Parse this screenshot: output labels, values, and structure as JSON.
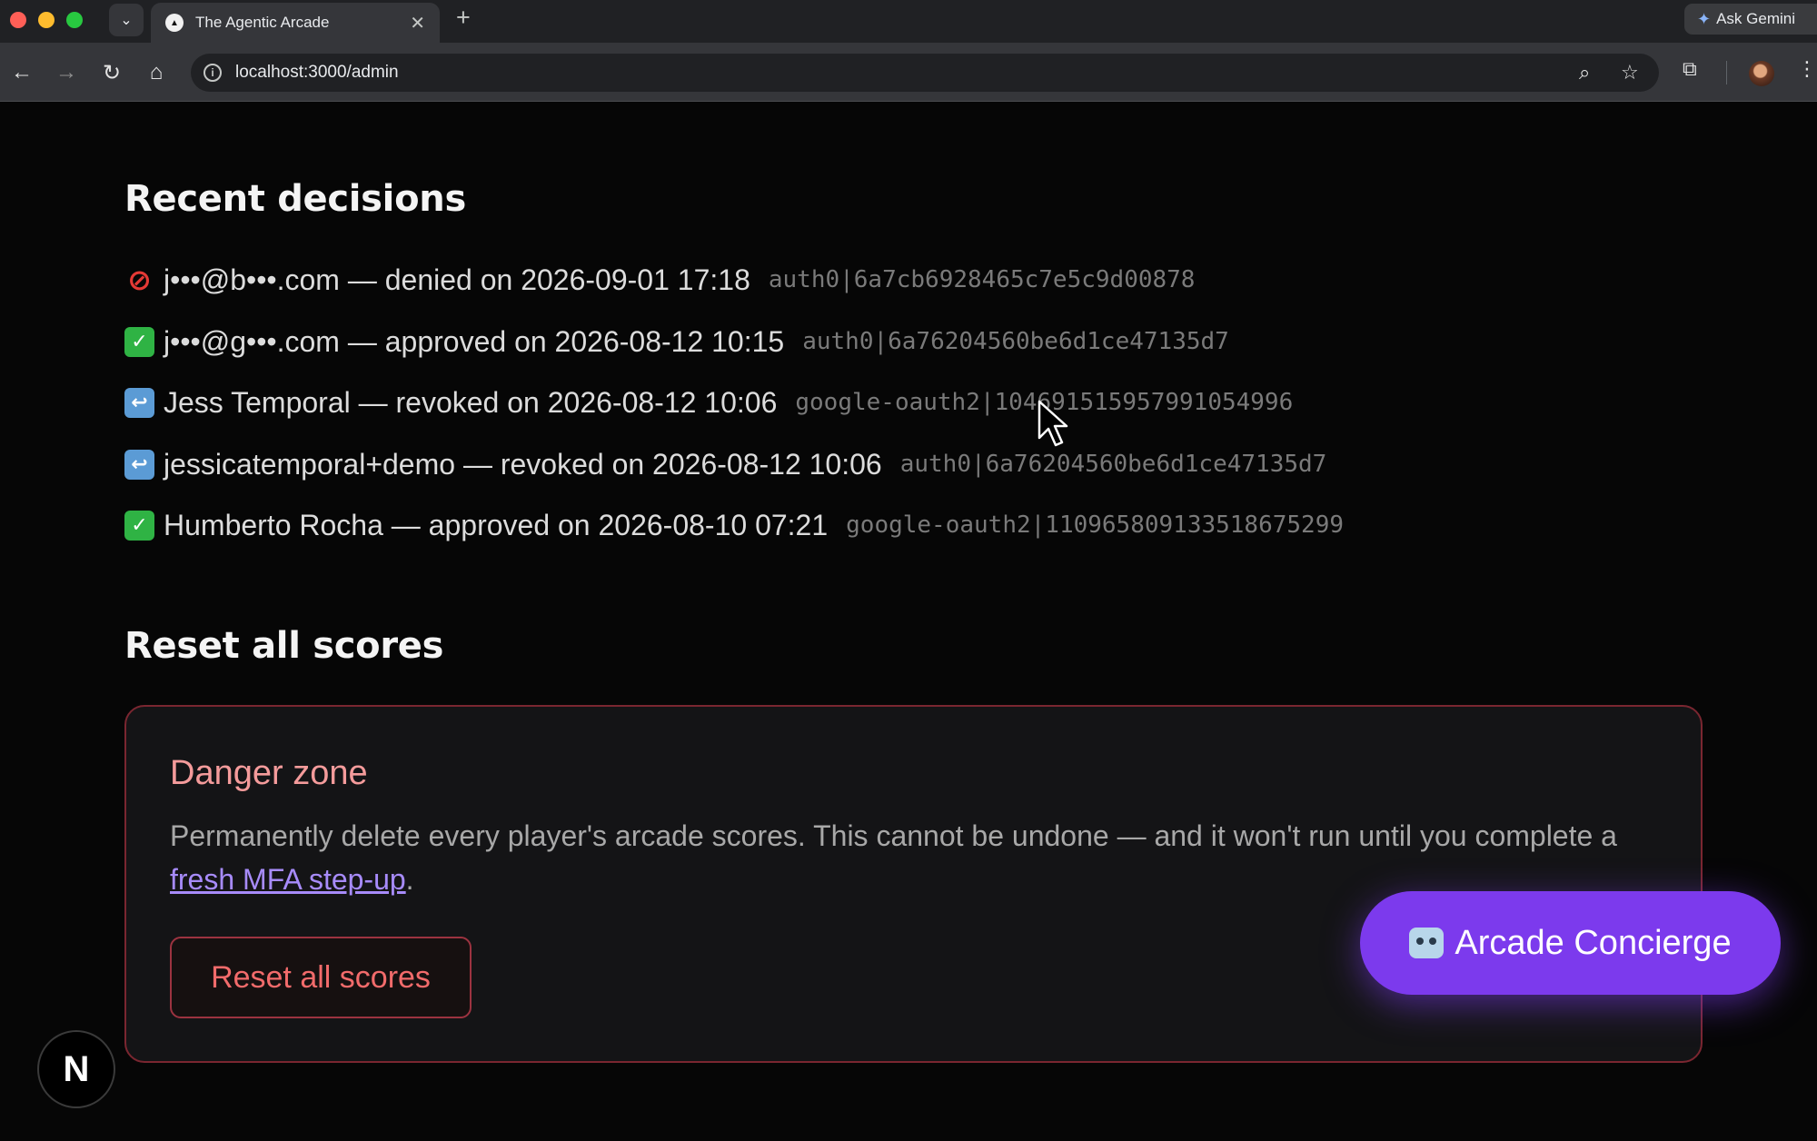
{
  "browser": {
    "tab_title": "The Agentic Arcade",
    "url": "localhost:3000/admin",
    "gemini_label": "Ask Gemini"
  },
  "decisions_section": {
    "title": "Recent decisions",
    "items": [
      {
        "status": "denied",
        "icon": "prohibited-icon",
        "text": "j•••@b•••.com — denied on 2026-09-01 17:18",
        "id": "auth0|6a7cb6928465c7e5c9d00878"
      },
      {
        "status": "approved",
        "icon": "check-icon",
        "text": "j•••@g•••.com — approved on 2026-08-12 10:15",
        "id": "auth0|6a76204560be6d1ce47135d7"
      },
      {
        "status": "revoked",
        "icon": "return-arrow-icon",
        "text": "Jess Temporal — revoked on 2026-08-12 10:06",
        "id": "google-oauth2|104691515957991054996"
      },
      {
        "status": "revoked",
        "icon": "return-arrow-icon",
        "text": "jessicatemporal+demo — revoked on 2026-08-12 10:06",
        "id": "auth0|6a76204560be6d1ce47135d7"
      },
      {
        "status": "approved",
        "icon": "check-icon",
        "text": "Humberto Rocha — approved on 2026-08-10 07:21",
        "id": "google-oauth2|110965809133518675299"
      }
    ]
  },
  "reset_section": {
    "title": "Reset all scores",
    "danger_title": "Danger zone",
    "description_before": "Permanently delete every player's arcade scores. This cannot be undone — and it won't run until you complete a ",
    "link_text": "fresh MFA step-up",
    "description_after": ".",
    "button_label": "Reset all scores"
  },
  "concierge": {
    "label": "Arcade Concierge"
  },
  "dev_badge": {
    "label": "N"
  },
  "colors": {
    "accent": "#7c3aed",
    "danger": "#f26b6b",
    "approved": "#2fb344",
    "revoked": "#5b9bd5"
  }
}
